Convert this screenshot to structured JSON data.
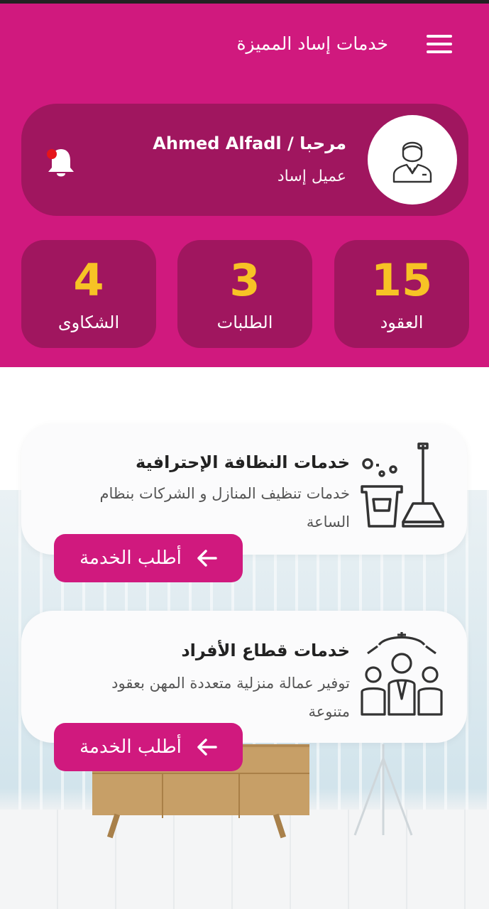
{
  "header": {
    "app_title": "خدمات إساد المميزة",
    "bg_color": "#d0197e",
    "card_color": "#a0165f"
  },
  "profile": {
    "greeting": "مرحبا / Ahmed Alfadl",
    "role": "عميل إساد"
  },
  "stats": [
    {
      "value": "15",
      "label": "العقود"
    },
    {
      "value": "3",
      "label": "الطلبات"
    },
    {
      "value": "4",
      "label": "الشكاوى"
    }
  ],
  "services": [
    {
      "title": "خدمات النظافة الإحترافية",
      "description": "خدمات تنظيف المنازل و الشركات بنظام الساعة",
      "button_label": "أطلب الخدمة",
      "icon": "cleaning-bucket-broom-icon"
    },
    {
      "title": "خدمات قطاع الأفراد",
      "description": "توفير عمالة منزلية متعددة المهن بعقود متنوعة",
      "button_label": "أطلب الخدمة",
      "icon": "workers-group-icon"
    }
  ]
}
